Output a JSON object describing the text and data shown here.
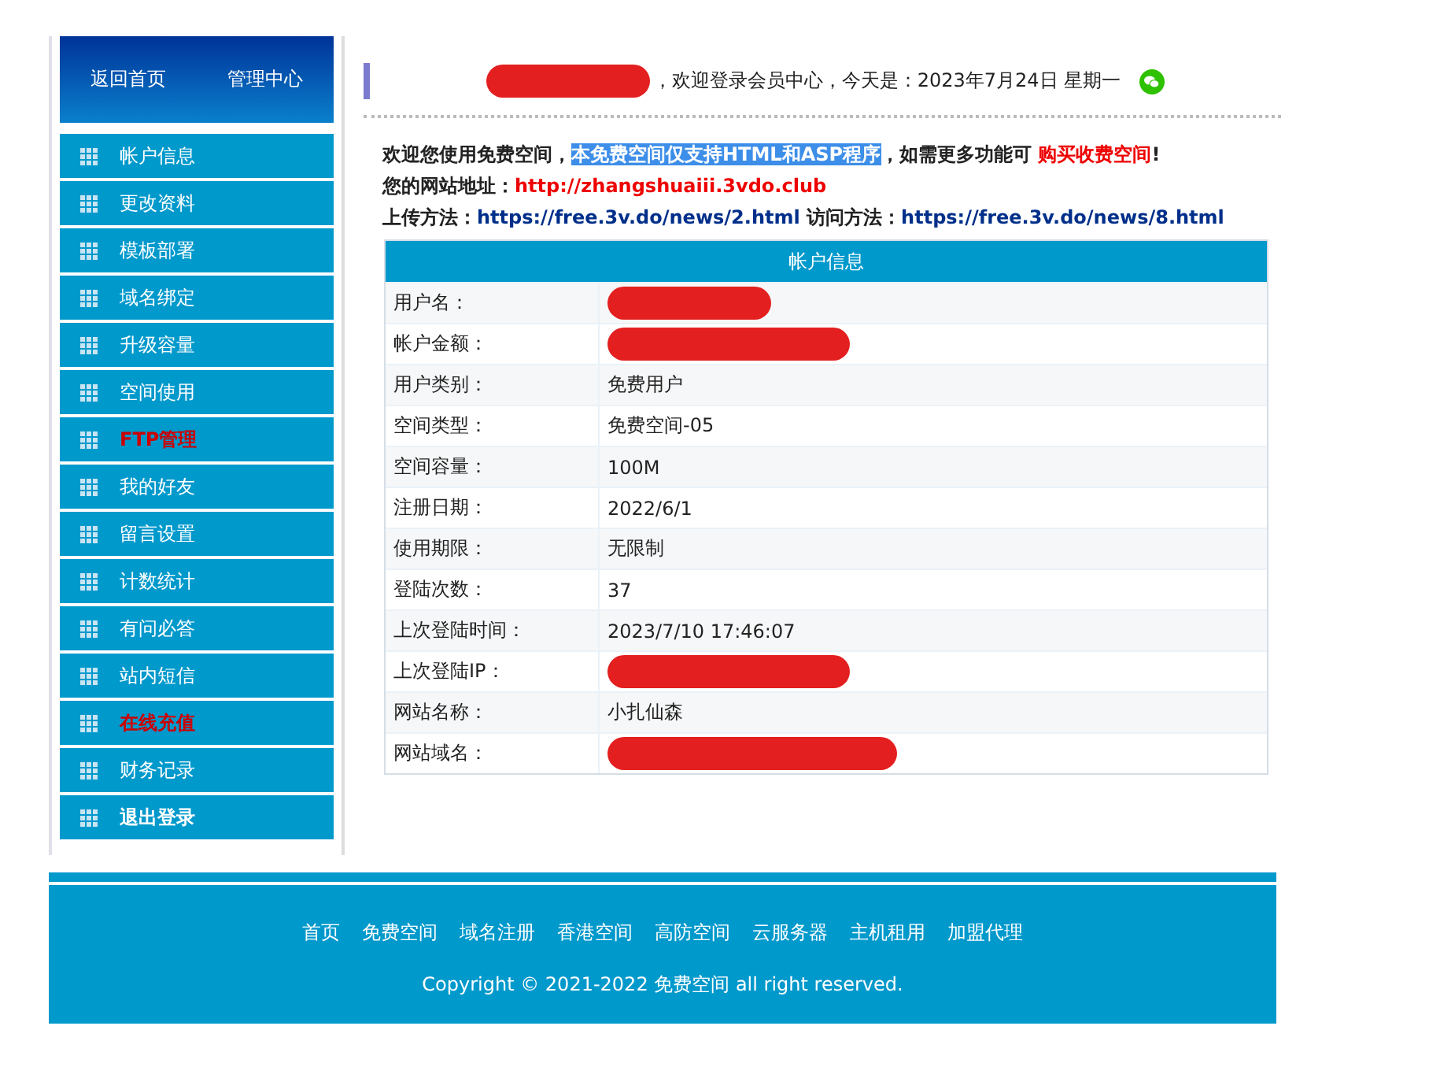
{
  "sidebar": {
    "header_links": [
      "返回首页",
      "管理中心"
    ],
    "items": [
      {
        "label": "帐户信息",
        "kind": "normal"
      },
      {
        "label": "更改资料",
        "kind": "normal"
      },
      {
        "label": "模板部署",
        "kind": "normal"
      },
      {
        "label": "域名绑定",
        "kind": "normal"
      },
      {
        "label": "升级容量",
        "kind": "normal"
      },
      {
        "label": "空间使用",
        "kind": "normal"
      },
      {
        "label": "FTP管理",
        "kind": "alert"
      },
      {
        "label": "我的好友",
        "kind": "normal"
      },
      {
        "label": "留言设置",
        "kind": "normal"
      },
      {
        "label": "计数统计",
        "kind": "normal"
      },
      {
        "label": "有问必答",
        "kind": "normal"
      },
      {
        "label": "站内短信",
        "kind": "normal"
      },
      {
        "label": "在线充值",
        "kind": "alert"
      },
      {
        "label": "财务记录",
        "kind": "normal"
      },
      {
        "label": "退出登录",
        "kind": "strong"
      }
    ]
  },
  "greeting": {
    "name_redacted": true,
    "text": "，欢迎登录会员中心，今天是：2023年7月24日 星期一"
  },
  "intro": {
    "segments": [
      {
        "kind": "text",
        "text": "欢迎您使用免费空间，"
      },
      {
        "kind": "highlight",
        "text": "本免费空间仅支持HTML和ASP程序"
      },
      {
        "kind": "text",
        "text": "，如需更多功能可 "
      },
      {
        "kind": "link",
        "text": "购买收费空间"
      },
      {
        "kind": "text",
        "text": "!"
      }
    ],
    "site_label": "您的网站地址：",
    "site_url": "http://zhangshuaiii.3vdo.club",
    "upload_label": "上传方法：",
    "upload_url": "https://free.3v.do/news/2.html",
    "visit_label": " 访问方法：",
    "visit_url": "https://free.3v.do/news/8.html"
  },
  "table": {
    "title": "帐户信息",
    "rows": [
      {
        "label": "用户名：",
        "redacted": true
      },
      {
        "label": "帐户金额：",
        "redacted": true
      },
      {
        "label": "用户类别：",
        "value": "免费用户",
        "redacted": false
      },
      {
        "label": "空间类型：",
        "value": "免费空间-05",
        "redacted": false
      },
      {
        "label": "空间容量：",
        "value": "100M",
        "redacted": false
      },
      {
        "label": "注册日期：",
        "value": "2022/6/1",
        "redacted": false
      },
      {
        "label": "使用期限：",
        "value": "无限制",
        "redacted": false
      },
      {
        "label": "登陆次数：",
        "value": "37",
        "redacted": false
      },
      {
        "label": "上次登陆时间：",
        "value": "2023/7/10 17:46:07",
        "redacted": false
      },
      {
        "label": "上次登陆IP：",
        "redacted": true
      },
      {
        "label": "网站名称：",
        "value": "小扎仙森",
        "redacted": false
      },
      {
        "label": "网站域名：",
        "redacted": true
      }
    ]
  },
  "footer": {
    "links": [
      "首页",
      "免费空间",
      "域名注册",
      "香港空间",
      "高防空间",
      "云服务器",
      "主机租用",
      "加盟代理"
    ],
    "copyright": "Copyright © 2021-2022 免费空间 all right reserved."
  }
}
